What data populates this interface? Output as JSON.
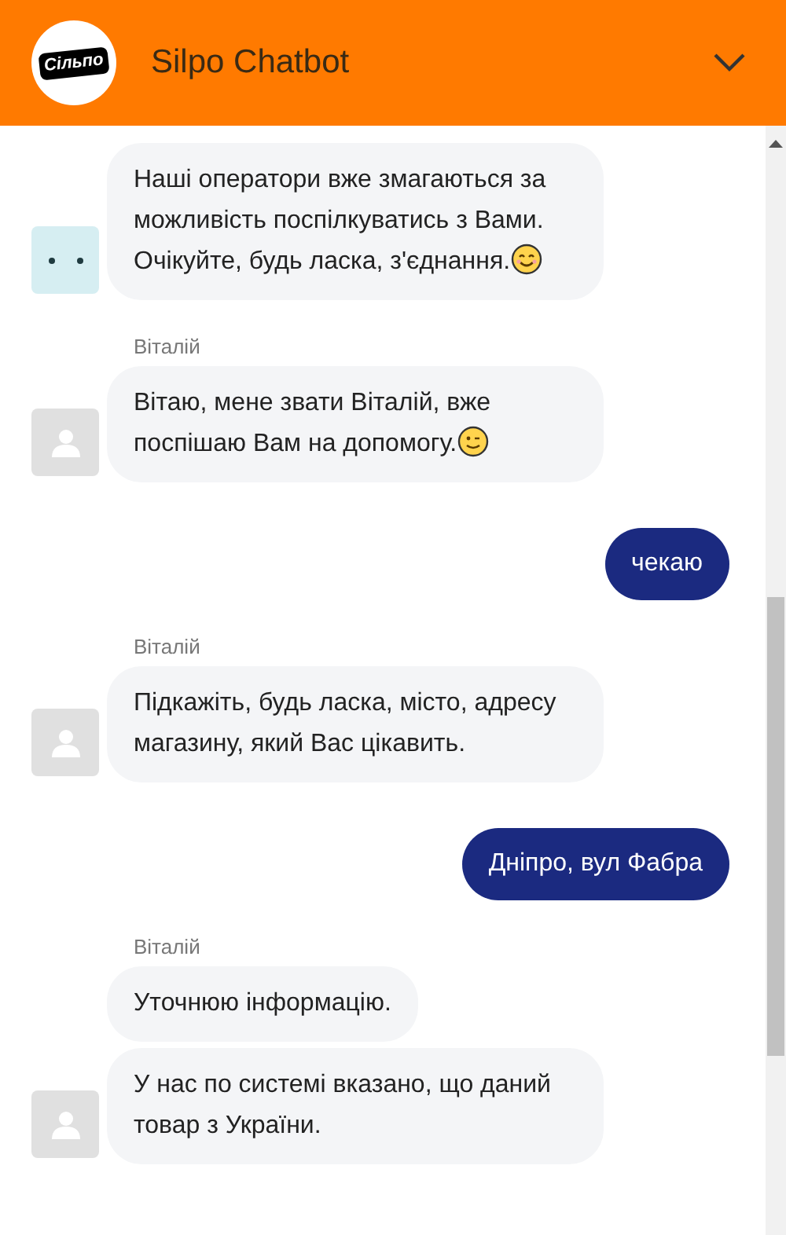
{
  "header": {
    "logo_text": "Сільпо",
    "title": "Silpo Chatbot"
  },
  "messages": [
    {
      "kind": "agent",
      "avatar": {
        "kind": "bot"
      },
      "messages": [
        {
          "text": "Наші оператори вже змагаються за можливість поспілкуватись з Вами. Очікуйте, будь ласка, з'єднання.",
          "emoji": {
            "kind": "smile"
          }
        }
      ]
    },
    {
      "kind": "agent",
      "avatar": {
        "kind": "person"
      },
      "sender": "Віталій",
      "messages": [
        {
          "text": "Вітаю, мене звати Віталій, вже поспішаю Вам на допомогу.",
          "emoji": {
            "kind": "wink"
          }
        }
      ]
    },
    {
      "kind": "user",
      "messages": [
        {
          "text": "чекаю"
        }
      ]
    },
    {
      "kind": "agent",
      "avatar": {
        "kind": "person"
      },
      "sender": "Віталій",
      "messages": [
        {
          "text": "Підкажіть, будь ласка, місто, адресу магазину, який Вас цікавить."
        }
      ]
    },
    {
      "kind": "user",
      "messages": [
        {
          "text": "Дніпро, вул Фабра"
        }
      ]
    },
    {
      "kind": "agent",
      "avatar": {
        "kind": "person"
      },
      "sender": "Віталій",
      "messages": [
        {
          "text": "Уточнюю інформацію."
        },
        {
          "text": "У нас по системі вказано, що даний товар з України."
        }
      ]
    }
  ]
}
